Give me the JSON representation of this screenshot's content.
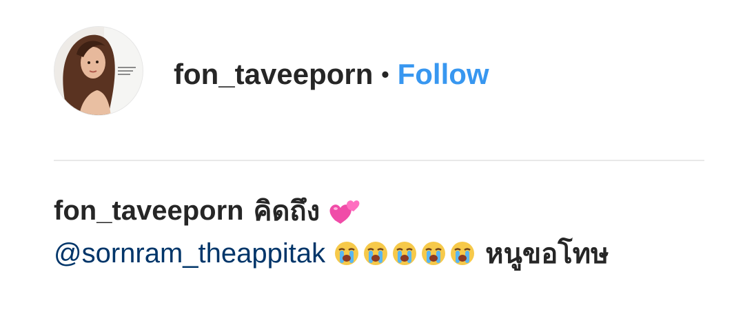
{
  "post": {
    "username": "fon_taveeporn",
    "separator": "•",
    "follow_label": "Follow",
    "avatar_icon": "profile-avatar",
    "caption": {
      "username": "fon_taveeporn",
      "text_1": "คิดถึง",
      "emoji_1": "two-hearts-icon",
      "mention": "@sornram_theappitak",
      "crying_emoji_count_icon": "loudly-crying-face-icon",
      "text_2": "หนูขอโทษ"
    }
  },
  "colors": {
    "link": "#3897f0",
    "mention": "#003569",
    "text": "#262626",
    "divider": "#e8e8e8"
  }
}
